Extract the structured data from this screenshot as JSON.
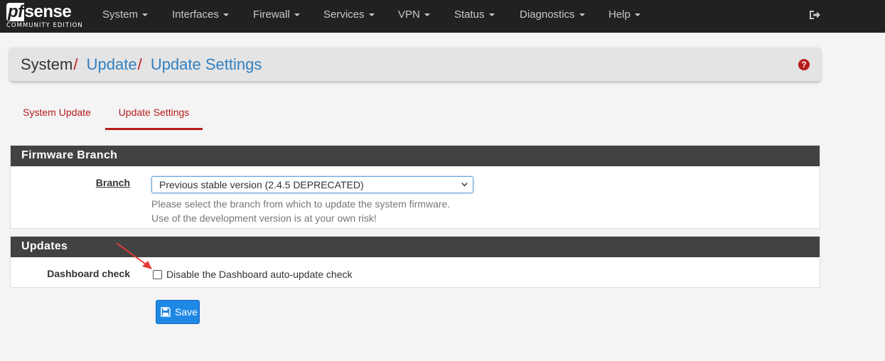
{
  "brand": {
    "logo_pf": "pf",
    "logo_sense": "sense",
    "edition": "COMMUNITY EDITION"
  },
  "nav": {
    "items": [
      {
        "label": "System"
      },
      {
        "label": "Interfaces"
      },
      {
        "label": "Firewall"
      },
      {
        "label": "Services"
      },
      {
        "label": "VPN"
      },
      {
        "label": "Status"
      },
      {
        "label": "Diagnostics"
      },
      {
        "label": "Help"
      }
    ],
    "logout_icon": "sign-out-icon"
  },
  "breadcrumb": {
    "root": "System",
    "sep": "/",
    "level1": "Update",
    "level2": "Update Settings",
    "help_icon": "question-circle-icon",
    "help_glyph": "?"
  },
  "tabs": [
    {
      "label": "System Update",
      "active": false
    },
    {
      "label": "Update Settings",
      "active": true
    }
  ],
  "firmware_branch": {
    "heading": "Firmware Branch",
    "branch_label": "Branch",
    "branch_value": "Previous stable version (2.4.5 DEPRECATED)",
    "help_line1": "Please select the branch from which to update the system firmware.",
    "help_line2": "Use of the development version is at your own risk!"
  },
  "updates": {
    "heading": "Updates",
    "dashboard_label": "Dashboard check",
    "checkbox_label": "Disable the Dashboard auto-update check",
    "checked": false
  },
  "save": {
    "label": "Save",
    "icon": "floppy-disk-icon"
  },
  "colors": {
    "navbar": "#212121",
    "accent_red": "#b71c1c",
    "link_blue": "#2f80c1",
    "panel_heading": "#424242",
    "primary_button": "#1e88e5"
  }
}
